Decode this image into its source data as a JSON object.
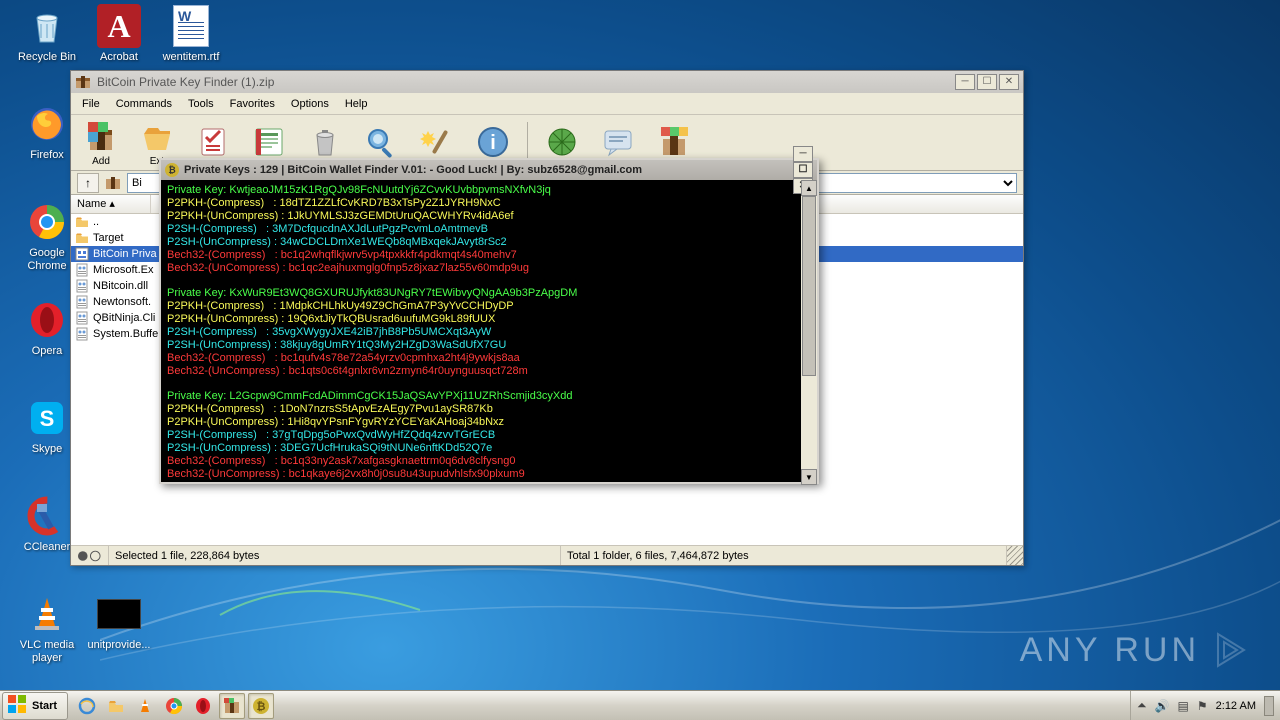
{
  "desktop_icons": {
    "recycle": "Recycle Bin",
    "acrobat": "Acrobat",
    "wentitem": "wentitem.rtf",
    "firefox": "Firefox",
    "chrome": "Google Chrome",
    "opera": "Opera",
    "skype": "Skype",
    "ccleaner": "CCleaner",
    "vlc": "VLC media player",
    "unitprov": "unitprovide..."
  },
  "winrar": {
    "title": "BitCoin Private Key Finder (1).zip",
    "menu": [
      "File",
      "Commands",
      "Tools",
      "Favorites",
      "Options",
      "Help"
    ],
    "tools": [
      "Add",
      "Ext"
    ],
    "name_col": "Name",
    "path_option": "Bi",
    "files": [
      {
        "name": "..",
        "type": "up"
      },
      {
        "name": "Target",
        "type": "folder"
      },
      {
        "name": "BitCoin Priva",
        "type": "exe",
        "sel": true
      },
      {
        "name": "Microsoft.Ex",
        "type": "dll"
      },
      {
        "name": "NBitcoin.dll",
        "type": "dll"
      },
      {
        "name": "Newtonsoft.",
        "type": "dll"
      },
      {
        "name": "QBitNinja.Cli",
        "type": "dll"
      },
      {
        "name": "System.Buffe",
        "type": "dll"
      }
    ],
    "status_left": "Selected 1 file, 228,864 bytes",
    "status_right": "Total 1 folder, 6 files, 7,464,872 bytes"
  },
  "console": {
    "title": "Private Keys : 129 |  BitCoin Wallet Finder V.01: - Good Luck! | By: subz6528@gmail.com",
    "blocks": [
      {
        "pk": "Private Key: KwtjeaoJM15zK1RgQJv98FcNUutdYj6ZCvvKUvbbpvmsNXfvN3jq",
        "p2pkh_c": "P2PKH-(Compress)   : 18dTZ1ZZLfCvKRD7B3xTsPy2Z1JYRH9NxC",
        "p2pkh_u": "P2PKH-(UnCompress) : 1JkUYMLSJ3zGEMDtUruQACWHYRv4idA6ef",
        "p2sh_c": "P2SH-(Compress)   : 3M7DcfqucdnAXJdLutPgzPcvmLoAmtmevB",
        "p2sh_u": "P2SH-(UnCompress) : 34wCDCLDmXe1WEQb8qMBxqekJAvyt8rSc2",
        "bech_c": "Bech32-(Compress)   : bc1q2whqflkjwrv5vp4tpxkkfr4pdkmqt4s40mehv7",
        "bech_u": "Bech32-(UnCompress) : bc1qc2eajhuxmglg0fnp5z8jxaz7laz55v60mdp9ug"
      },
      {
        "pk": "Private Key: KxWuR9Et3WQ8GXURUJfykt83UNgRY7tEWibvyQNgAA9b3PzApgDM",
        "p2pkh_c": "P2PKH-(Compress)   : 1MdpkCHLhkUy49Z9ChGmA7P3yYvCCHDyDP",
        "p2pkh_u": "P2PKH-(UnCompress) : 19Q6xtJiyTkQBUsrad6uufuMG9kL89fUUX",
        "p2sh_c": "P2SH-(Compress)   : 35vgXWygyJXE42iB7jhB8Pb5UMCXqt3AyW",
        "p2sh_u": "P2SH-(UnCompress) : 38kjuy8gUmRY1tQ3My2HZgD3WaSdUfX7GU",
        "bech_c": "Bech32-(Compress)   : bc1qufv4s78e72a54yrzv0cpmhxa2ht4j9ywkjs8aa",
        "bech_u": "Bech32-(UnCompress) : bc1qts0c6t4gnlxr6vn2zmyn64r0uynguusqct728m"
      },
      {
        "pk": "Private Key: L2Gcpw9CmmFcdADimmCgCK15JaQSAvYPXj11UZRhScmjid3cyXdd",
        "p2pkh_c": "P2PKH-(Compress)   : 1DoN7nzrsS5tApvEzAEgy7Pvu1aySR87Kb",
        "p2pkh_u": "P2PKH-(UnCompress) : 1Hi8qvYPsnFYgvRYzYCEYaKAHoaj34bNxz",
        "p2sh_c": "P2SH-(Compress)   : 37gTqDpg5oPwxQvdWyHfZQdq4zvvTGrECB",
        "p2sh_u": "P2SH-(UnCompress) : 3DEG7UcfHrukaSQi9tNUNe6nftKDd52Q7e",
        "bech_c": "Bech32-(Compress)   : bc1q33ny2ask7xafgasgknaettrm0q6dv8clfysng0",
        "bech_u": "Bech32-(UnCompress) : bc1qkaye6j2vx8h0j0su8u43upudvhlsfx90plxum9"
      }
    ]
  },
  "taskbar": {
    "start": "Start",
    "clock": "2:12 AM"
  },
  "watermark": "ANY    RUN"
}
